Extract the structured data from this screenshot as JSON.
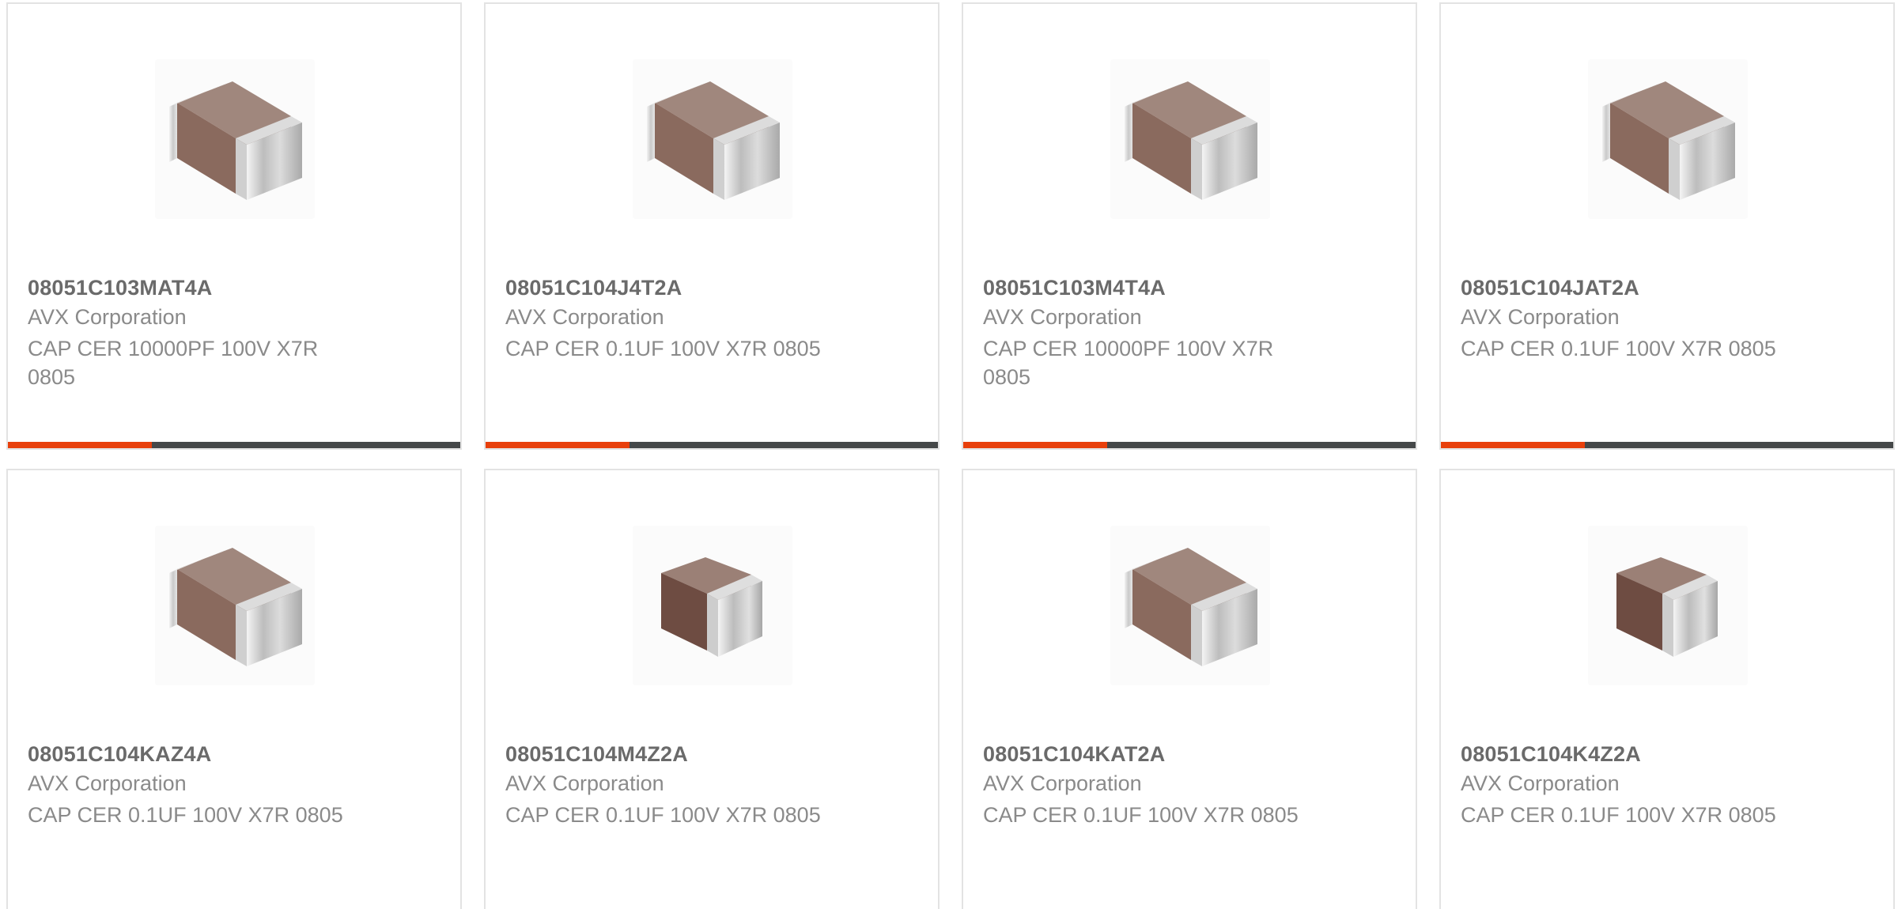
{
  "products": [
    {
      "part_number": "08051C103MAT4A",
      "manufacturer": "AVX Corporation",
      "description": "CAP CER 10000PF 100V X7R 0805",
      "image": "ceramic-capacitor-image",
      "variant": "wide"
    },
    {
      "part_number": "08051C104J4T2A",
      "manufacturer": "AVX Corporation",
      "description": "CAP CER 0.1UF 100V X7R 0805",
      "image": "ceramic-capacitor-image",
      "variant": "wide"
    },
    {
      "part_number": "08051C103M4T4A",
      "manufacturer": "AVX Corporation",
      "description": "CAP CER 10000PF 100V X7R 0805",
      "image": "ceramic-capacitor-image",
      "variant": "wide"
    },
    {
      "part_number": "08051C104JAT2A",
      "manufacturer": "AVX Corporation",
      "description": "CAP CER 0.1UF 100V X7R 0805",
      "image": "ceramic-capacitor-image",
      "variant": "wide"
    },
    {
      "part_number": "08051C104KAZ4A",
      "manufacturer": "AVX Corporation",
      "description": "CAP CER 0.1UF 100V X7R 0805",
      "image": "ceramic-capacitor-image",
      "variant": "wide"
    },
    {
      "part_number": "08051C104M4Z2A",
      "manufacturer": "AVX Corporation",
      "description": "CAP CER 0.1UF 100V X7R 0805",
      "image": "ceramic-capacitor-image",
      "variant": "compact"
    },
    {
      "part_number": "08051C104KAT2A",
      "manufacturer": "AVX Corporation",
      "description": "CAP CER 0.1UF 100V X7R 0805",
      "image": "ceramic-capacitor-image",
      "variant": "wide"
    },
    {
      "part_number": "08051C104K4Z2A",
      "manufacturer": "AVX Corporation",
      "description": "CAP CER 0.1UF 100V X7R 0805",
      "image": "ceramic-capacitor-image",
      "variant": "compact"
    }
  ],
  "colors": {
    "accent": "#e8400c",
    "bar": "#454849",
    "card_border": "#e3e3e3",
    "part_text": "#6a6a6a",
    "secondary_text": "#8a8a8a",
    "capacitor_body": "#8a6a5e",
    "capacitor_body_dark": "#6e4c42"
  }
}
